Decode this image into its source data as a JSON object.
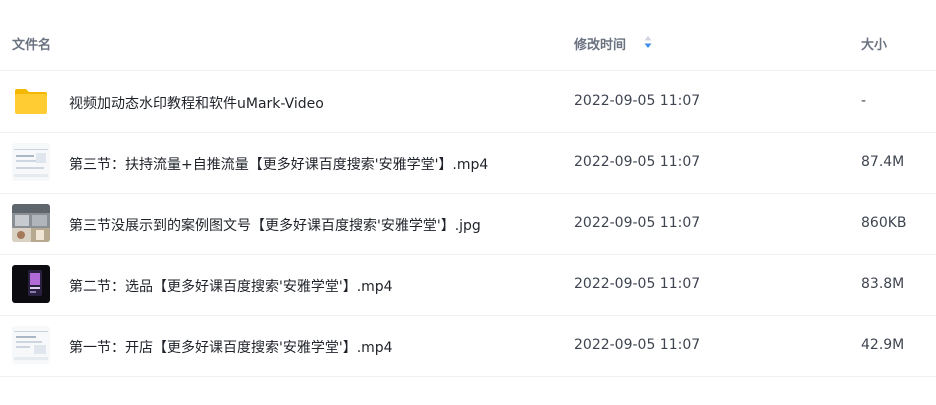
{
  "header": {
    "name": "文件名",
    "modified": "修改时间",
    "size": "大小"
  },
  "sort_icon": "sort-indicator-icon",
  "files": [
    {
      "name": "视频加动态水印教程和软件uMark-Video",
      "modified": "2022-09-05 11:07",
      "size": "-",
      "icon": "folder-icon"
    },
    {
      "name": "第三节：扶持流量+自推流量【更多好课百度搜索'安雅学堂'】.mp4",
      "modified": "2022-09-05 11:07",
      "size": "87.4M",
      "icon": "video-thumbnail"
    },
    {
      "name": "第三节没展示到的案例图文号【更多好课百度搜索'安雅学堂'】.jpg",
      "modified": "2022-09-05 11:07",
      "size": "860KB",
      "icon": "image-thumbnail"
    },
    {
      "name": "第二节：选品【更多好课百度搜索'安雅学堂'】.mp4",
      "modified": "2022-09-05 11:07",
      "size": "83.8M",
      "icon": "video-thumbnail"
    },
    {
      "name": "第一节：开店【更多好课百度搜索'安雅学堂'】.mp4",
      "modified": "2022-09-05 11:07",
      "size": "42.9M",
      "icon": "video-thumbnail"
    }
  ]
}
